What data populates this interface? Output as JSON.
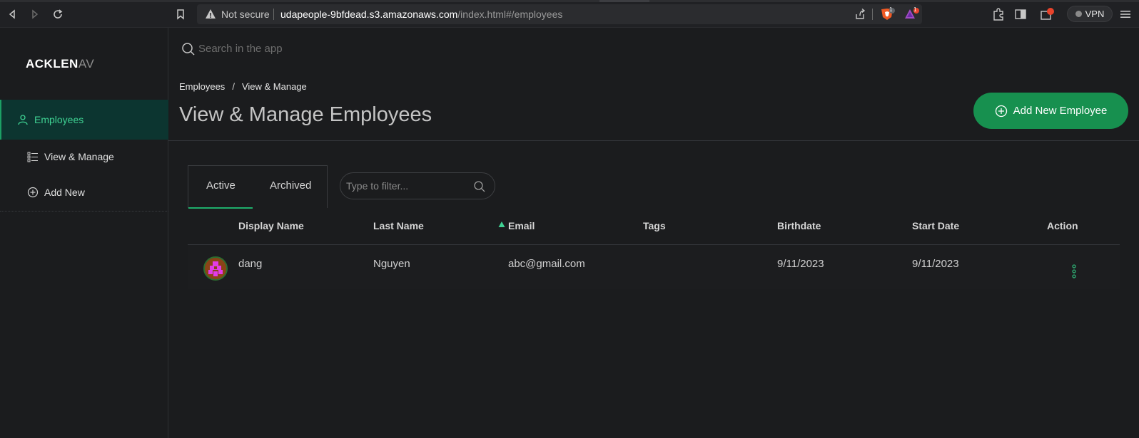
{
  "browser": {
    "not_secure_label": "Not secure",
    "url_host": "udapeople-9bfdead.s3.amazonaws.com",
    "url_path": "/index.html#/employees",
    "vpn_label": "VPN",
    "shields_count": "1",
    "rewards_count": "1"
  },
  "sidebar": {
    "logo_main": "ACKLEN",
    "logo_faded": "AV",
    "items": [
      {
        "label": "Employees",
        "icon": "user-icon",
        "active": true
      },
      {
        "label": "View & Manage",
        "icon": "list-icon",
        "active": false
      },
      {
        "label": "Add New",
        "icon": "plus-circle-icon",
        "active": false
      }
    ]
  },
  "search": {
    "placeholder": "Search in the app"
  },
  "breadcrumb": {
    "parent": "Employees",
    "separator": "/",
    "current": "View & Manage"
  },
  "page_title": "View & Manage Employees",
  "add_button": {
    "label": "Add New Employee",
    "color": "#17904f"
  },
  "tabs": [
    {
      "label": "Active",
      "selected": true
    },
    {
      "label": "Archived",
      "selected": false
    }
  ],
  "filter": {
    "placeholder": "Type to filter..."
  },
  "table": {
    "columns": [
      "Display Name",
      "Last Name",
      "Email",
      "Tags",
      "Birthdate",
      "Start Date",
      "Action"
    ],
    "sorted_column": "Email",
    "sort_direction": "ascending",
    "rows": [
      {
        "display_name": "dang",
        "last_name": "Nguyen",
        "email": "abc@gmail.com",
        "tags": "",
        "birthdate": "9/11/2023",
        "start_date": "9/11/2023"
      }
    ]
  },
  "colors": {
    "accent": "#1fae6c",
    "sidebar_active_bg": "#0c3530",
    "background": "#1b1c1e"
  }
}
